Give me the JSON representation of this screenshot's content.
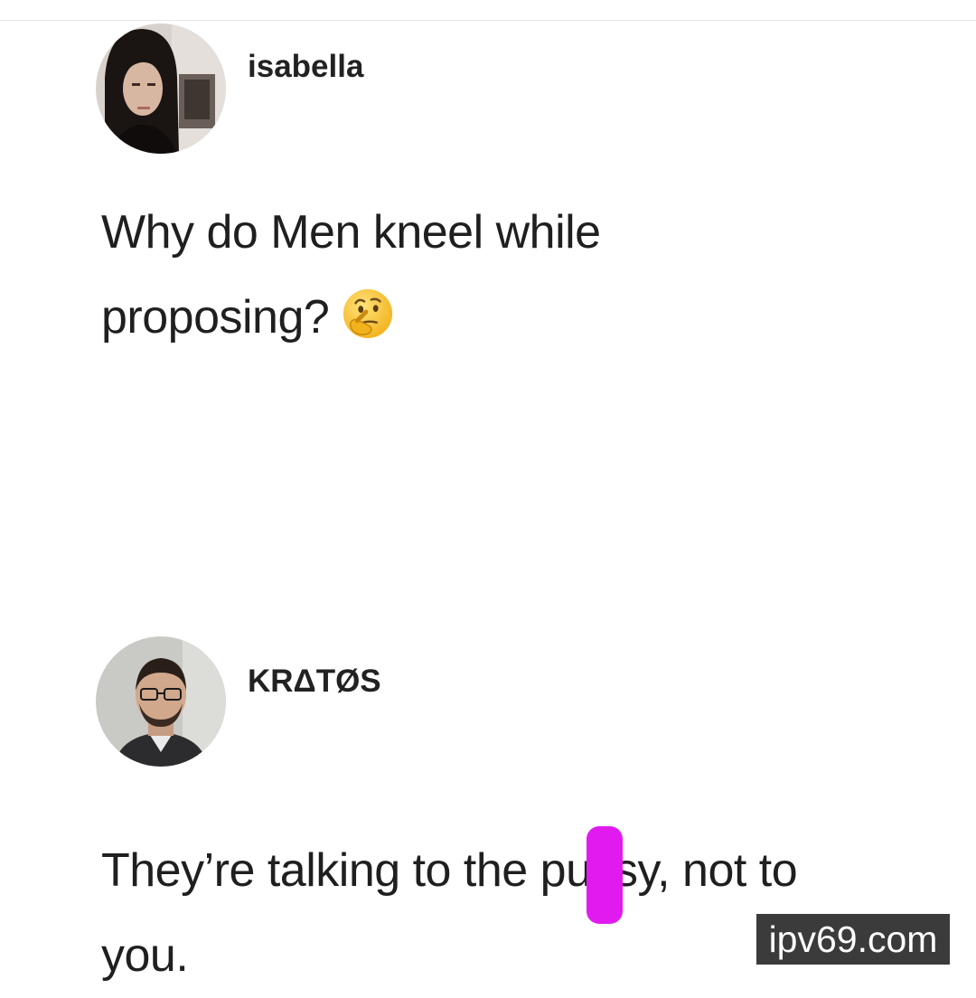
{
  "posts": [
    {
      "username": "isabella",
      "avatar_icon": "user-photo-icon",
      "text_line_1": "Why do Men kneel while",
      "text_line_2": "proposing?",
      "emoji": "thinking-face-icon"
    },
    {
      "username": "KRΔTØS",
      "avatar_icon": "user-photo-icon",
      "text_line_1_before": "They’re talking to the pu",
      "text_line_1_censored": "s",
      "text_line_1_after": "sy, not to",
      "text_line_2": "you.",
      "censor_color": "#e11bf0"
    }
  ],
  "watermark": "ipv69.com"
}
